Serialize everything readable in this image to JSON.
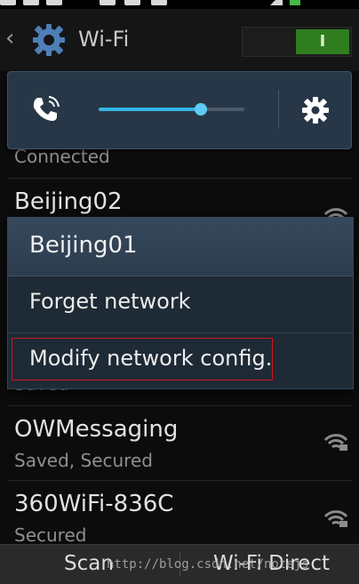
{
  "action_bar": {
    "title": "Wi-Fi",
    "toggle_label": "I"
  },
  "quick_panel": {
    "volume_level": 0.7
  },
  "networks": [
    {
      "name": "",
      "status": "Connected"
    },
    {
      "name": "Beijing02",
      "status": ""
    },
    {
      "name": "",
      "status": "Saved"
    },
    {
      "name": "OWMessaging",
      "status": "Saved, Secured"
    },
    {
      "name": "360WiFi-836C",
      "status": "Secured"
    }
  ],
  "dialog": {
    "title": "Beijing01",
    "options": [
      "Forget network",
      "Modify network config."
    ]
  },
  "bottom_bar": {
    "scan": "Scan",
    "wifi_direct": "Wi-Fi Direct"
  },
  "watermark": "http://blog.csdn.net/notejs",
  "colors": {
    "accent": "#35b4e4",
    "toggle_on": "#2f7d1f",
    "highlight": "#d0161f"
  }
}
